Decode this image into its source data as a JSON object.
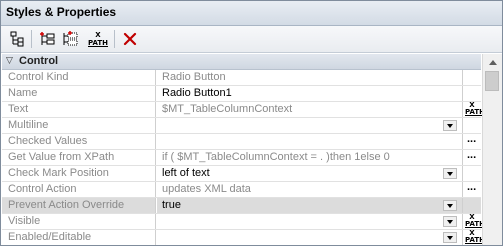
{
  "window": {
    "title": "Styles & Properties"
  },
  "toolbar": {
    "buttons": [
      {
        "icon": "tree-view-icon"
      },
      {
        "icon": "add-property-icon"
      },
      {
        "icon": "add-child-property-icon"
      },
      {
        "icon": "xpath-icon",
        "label_top": "X",
        "label_bottom": "PATH"
      },
      {
        "icon": "delete-icon",
        "color": "#c00000"
      }
    ]
  },
  "group": {
    "name": "Control",
    "collapse_glyph": "▽"
  },
  "xpath_button": {
    "top": "X",
    "bottom": "PATH"
  },
  "dots_label": "...",
  "rows": [
    {
      "name": "Control Kind",
      "value": "Radio Button",
      "value_set": false,
      "editor": "none",
      "highlighted": false
    },
    {
      "name": "Name",
      "value": "Radio Button1",
      "value_set": true,
      "editor": "none",
      "highlighted": false
    },
    {
      "name": "Text",
      "value": "$MT_TableColumnContext",
      "value_set": false,
      "editor": "xpath",
      "highlighted": false
    },
    {
      "name": "Multiline",
      "value": "",
      "value_set": false,
      "editor": "dropdown",
      "highlighted": false
    },
    {
      "name": "Checked Values",
      "value": "",
      "value_set": false,
      "editor": "dots",
      "highlighted": false
    },
    {
      "name": "Get Value from XPath",
      "value": "if ( $MT_TableColumnContext = . )then 1else 0",
      "value_set": false,
      "editor": "dots",
      "highlighted": false
    },
    {
      "name": "Check Mark Position",
      "value": "left of text",
      "value_set": true,
      "editor": "dropdown",
      "highlighted": false
    },
    {
      "name": "Control Action",
      "value": "updates XML data",
      "value_set": false,
      "editor": "dots",
      "highlighted": false
    },
    {
      "name": "Prevent Action Override",
      "value": "true",
      "value_set": true,
      "editor": "dropdown",
      "highlighted": true
    },
    {
      "name": "Visible",
      "value": "",
      "value_set": false,
      "editor": "dropdown-xpath",
      "highlighted": false
    },
    {
      "name": "Enabled/Editable",
      "value": "",
      "value_set": false,
      "editor": "dropdown-xpath",
      "highlighted": false
    }
  ]
}
